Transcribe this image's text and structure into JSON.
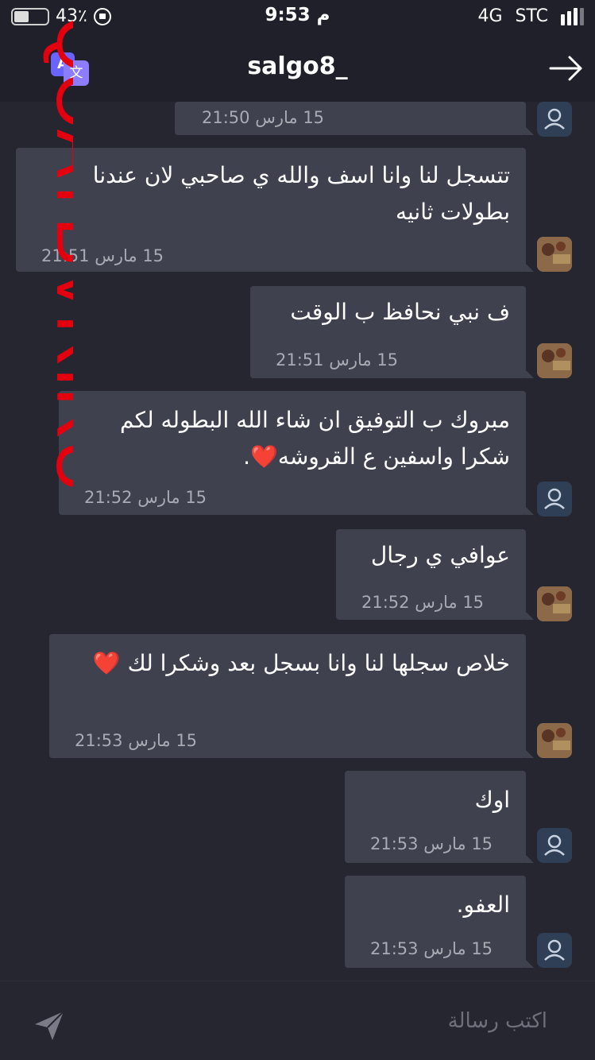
{
  "status_bar": {
    "battery": "43٪",
    "time": "9:53 م",
    "network": "4G",
    "carrier": "STC"
  },
  "header": {
    "title": "salgo8_",
    "translate_icon": "translate-icon",
    "back_icon": "arrow-right-icon"
  },
  "messages": [
    {
      "text": "",
      "time": "15 مارس 21:50",
      "sender": "self"
    },
    {
      "text": "تتسجل لنا وانا اسف والله ي صاحبي لان عندنا بطولات ثانيه",
      "time": "15 مارس 21:51",
      "sender": "other"
    },
    {
      "text": "ف نبي نحافظ ب الوقت",
      "time": "15 مارس 21:51",
      "sender": "other"
    },
    {
      "text": "مبروك ب التوفيق ان شاء الله البطوله لكم شكرا واسفين ع القروشه❤️.",
      "time": "15 مارس 21:52",
      "sender": "self"
    },
    {
      "text": "عوافي ي رجال",
      "time": "15 مارس 21:52",
      "sender": "other"
    },
    {
      "text": "خلاص سجلها لنا وانا بسجل بعد وشكرا لك ❤️",
      "time": "15 مارس 21:53",
      "sender": "other"
    },
    {
      "text": "اوك",
      "time": "15 مارس 21:53",
      "sender": "self"
    },
    {
      "text": "العفو.",
      "time": "15 مارس 21:53",
      "sender": "self"
    }
  ],
  "input": {
    "placeholder": "اكتب رسالة"
  },
  "watermark": "QOATBVRIRU",
  "colors": {
    "background": "#252630",
    "bubble": "#40414e",
    "watermark": "#e3000f",
    "accent": "#6b63ff"
  }
}
